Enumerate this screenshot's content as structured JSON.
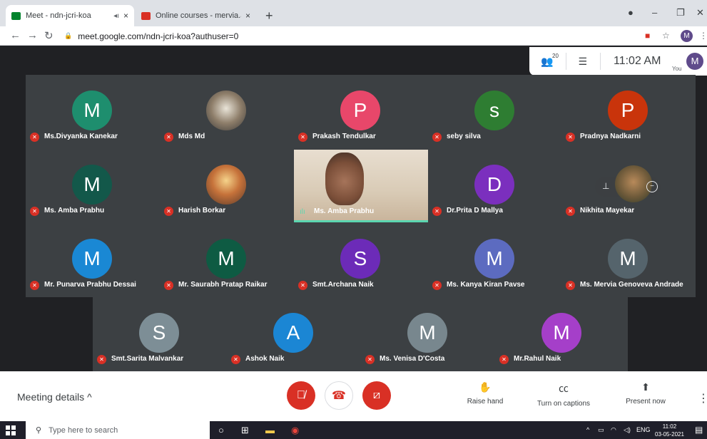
{
  "browser": {
    "tabs": [
      {
        "title": "Meet - ndn-jcri-koa",
        "active": true,
        "audio": "◂ı",
        "close": "×",
        "favicon_color": "#00832d"
      },
      {
        "title": "Online courses - mervia.andrade",
        "active": false,
        "close": "×",
        "favicon_color": "#d93025"
      }
    ],
    "new_tab": "+",
    "url": "meet.google.com/ndn-jcri-koa?authuser=0",
    "profile_initial": "M"
  },
  "meet_header": {
    "participants_count": "20",
    "clock": "11:02 AM",
    "you_label": "You",
    "self_initial": "M"
  },
  "participants": [
    {
      "name": "Ms.Divyanka Kanekar",
      "initial": "M",
      "color": "#1e8e6e",
      "photo": false
    },
    {
      "name": "Mds Md",
      "initial": "",
      "color": "",
      "photo": true
    },
    {
      "name": "Prakash Tendulkar",
      "initial": "P",
      "color": "#e8476a",
      "photo": false
    },
    {
      "name": "seby silva",
      "initial": "s",
      "color": "#2e7d32",
      "photo": false
    },
    {
      "name": "Pradnya Nadkarni",
      "initial": "P",
      "color": "#c9340b",
      "photo": false
    },
    {
      "name": "Ms. Amba Prabhu",
      "initial": "M",
      "color": "#13584a",
      "photo": false
    },
    {
      "name": "Harish Borkar",
      "initial": "",
      "color": "",
      "photo": true
    },
    {
      "name": "Dr.Prita D Mallya",
      "initial": "D",
      "color": "#7b2fbe",
      "photo": false
    },
    {
      "name": "Nikhita Mayekar",
      "initial": "",
      "color": "",
      "photo": true
    },
    {
      "name": "Mr. Punarva Prabhu Dessai",
      "initial": "M",
      "color": "#1a88d4",
      "photo": false
    },
    {
      "name": "Mr. Saurabh Pratap Raikar",
      "initial": "M",
      "color": "#0e5b43",
      "photo": false
    },
    {
      "name": "Smt.Archana Naik",
      "initial": "S",
      "color": "#6c2bb8",
      "photo": false
    },
    {
      "name": "Ms. Kanya Kiran Pavse",
      "initial": "M",
      "color": "#5c6bc0",
      "photo": false
    },
    {
      "name": "Ms. Mervia Genoveva Andrade",
      "initial": "M",
      "color": "#55646c",
      "photo": false
    },
    {
      "name": "Smt.Sarita Malvankar",
      "initial": "S",
      "color": "#7d8e96",
      "photo": false
    },
    {
      "name": "Ashok Naik",
      "initial": "A",
      "color": "#1b86d4",
      "photo": false
    },
    {
      "name": "Ms. Venisa D'Costa",
      "initial": "M",
      "color": "#78878e",
      "photo": false
    },
    {
      "name": "Mr.Rahul Naik",
      "initial": "M",
      "color": "#a53fc9",
      "photo": false
    }
  ],
  "active_speaker": {
    "name": "Ms. Amba Prabhu"
  },
  "bottom": {
    "meeting_details": "Meeting details",
    "raise_hand": "Raise hand",
    "captions": "Turn on captions",
    "present": "Present now"
  },
  "taskbar": {
    "search_placeholder": "Type here to search",
    "lang": "ENG",
    "time": "11:02",
    "date": "03-05-2021"
  }
}
